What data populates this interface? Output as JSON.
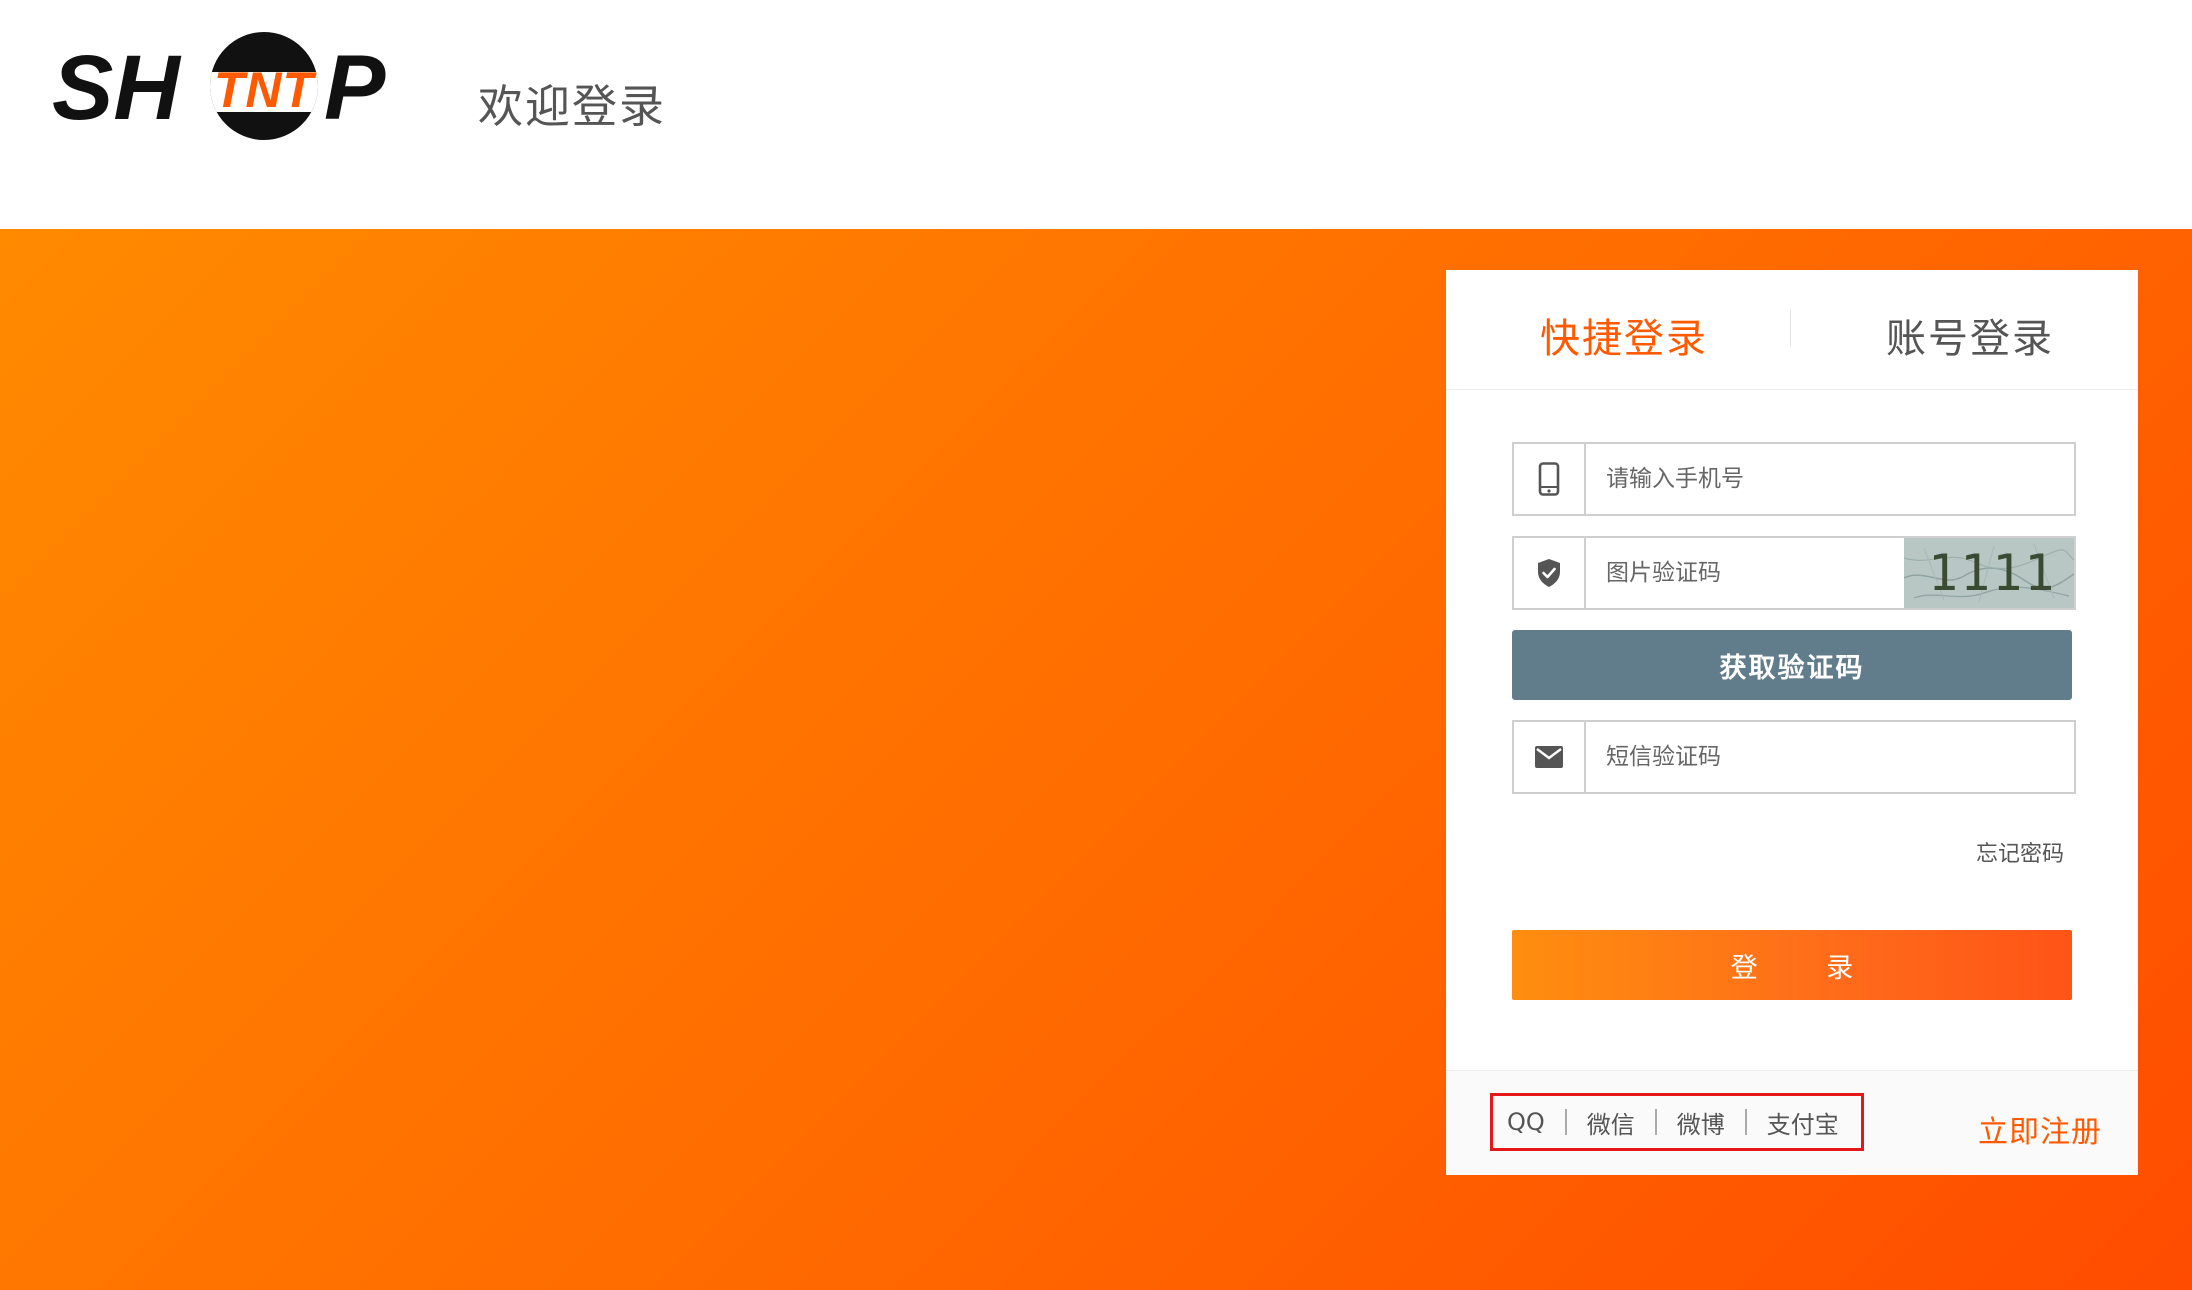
{
  "header": {
    "logo": {
      "brand": "SHTNTP",
      "left": "SH",
      "middle": "TNT",
      "right": "P"
    },
    "welcome": "欢迎登录"
  },
  "login": {
    "tabs": [
      {
        "label": "快捷登录",
        "active": true
      },
      {
        "label": "账号登录",
        "active": false
      }
    ],
    "phone": {
      "placeholder": "请输入手机号",
      "icon": "mobile-phone-icon"
    },
    "captcha": {
      "placeholder": "图片验证码",
      "icon": "shield-check-icon",
      "image_text": "1111"
    },
    "get_code_label": "获取验证码",
    "sms": {
      "placeholder": "短信验证码",
      "icon": "envelope-icon"
    },
    "forgot_password": "忘记密码",
    "login_button": "登 录",
    "third_party": [
      "QQ",
      "微信",
      "微博",
      "支付宝"
    ],
    "register": "立即注册"
  },
  "colors": {
    "accent": "#ff5a00",
    "banner_start": "#ff8a00",
    "banner_end": "#ff4c00",
    "get_code_button": "#617d8b",
    "highlight_box": "#e41818"
  }
}
